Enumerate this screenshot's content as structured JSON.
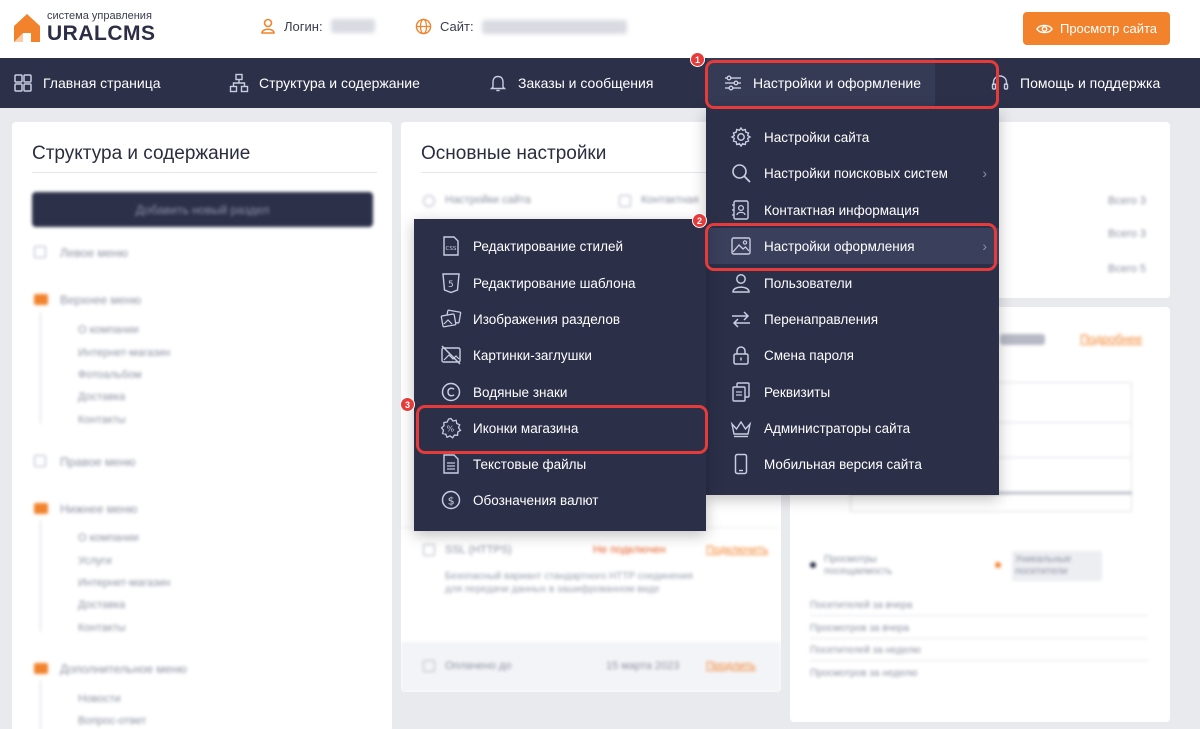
{
  "header": {
    "logo_sub": "система управления",
    "logo_main": "URALCMS",
    "login_label": "Логин:",
    "site_label": "Сайт:",
    "view_site_button": "Просмотр сайта"
  },
  "nav": {
    "items": [
      {
        "label": "Главная страница",
        "icon": "grid-icon"
      },
      {
        "label": "Структура и содержание",
        "icon": "sitemap-icon"
      },
      {
        "label": "Заказы и сообщения",
        "icon": "bell-icon"
      },
      {
        "label": "Настройки и оформление",
        "icon": "sliders-icon"
      },
      {
        "label": "Помощь и поддержка",
        "icon": "headset-icon"
      }
    ]
  },
  "left_panel": {
    "title": "Структура и содержание",
    "add_button": "Добавить новый раздел",
    "tree": [
      "Левое меню",
      "Верхнее меню",
      "О компании",
      "Интернет-магазин",
      "Фотоальбом",
      "Доставка",
      "Контакты",
      "Правое меню",
      "Нижнее меню",
      "О компании",
      "Услуги",
      "Интернет-магазин",
      "Доставка",
      "Контакты",
      "Дополнительное меню",
      "Новости",
      "Вопрос-ответ"
    ]
  },
  "middle_panel": {
    "title": "Основные настройки",
    "links": [
      "Настройки сайта",
      "Контактная"
    ],
    "ssl_label": "SSL (HTTPS)",
    "ssl_status": "Не подключен",
    "ssl_action": "Подключить",
    "ssl_desc": "Безопасный вариант стандартного HTTP соединения для передачи данных в зашифрованном виде",
    "paid_label": "Оплачено до",
    "paid_date": "15 марта 2023",
    "paid_action": "Продлить"
  },
  "right_panel": {
    "counts": [
      "Всего 3",
      "Всего 3",
      "Всего 5"
    ],
    "news_link": "Подробнее",
    "views": [
      "Просмотры посещаемость",
      "Уникальные посетители"
    ],
    "stats": [
      "Посетителей за вчера",
      "Просмотров за вчера",
      "Посетителей за неделю",
      "Просмотров за неделю"
    ]
  },
  "settings_menu": {
    "items": [
      {
        "label": "Настройки сайта",
        "icon": "gear-icon",
        "submenu": false
      },
      {
        "label": "Настройки поисковых систем",
        "icon": "search-icon",
        "submenu": true
      },
      {
        "label": "Контактная информация",
        "icon": "contact-card-icon",
        "submenu": false
      },
      {
        "label": "Настройки оформления",
        "icon": "image-icon",
        "submenu": true
      },
      {
        "label": "Пользователи",
        "icon": "user-icon",
        "submenu": false
      },
      {
        "label": "Перенаправления",
        "icon": "arrows-icon",
        "submenu": false
      },
      {
        "label": "Смена пароля",
        "icon": "lock-icon",
        "submenu": false
      },
      {
        "label": "Реквизиты",
        "icon": "documents-icon",
        "submenu": false
      },
      {
        "label": "Администраторы сайта",
        "icon": "crown-icon",
        "submenu": false
      },
      {
        "label": "Мобильная версия сайта",
        "icon": "mobile-icon",
        "submenu": false
      }
    ]
  },
  "design_menu": {
    "items": [
      {
        "label": "Редактирование стилей",
        "icon": "css-file-icon"
      },
      {
        "label": "Редактирование шаблона",
        "icon": "html5-icon"
      },
      {
        "label": "Изображения разделов",
        "icon": "pictures-icon"
      },
      {
        "label": "Картинки-заглушки",
        "icon": "no-image-icon"
      },
      {
        "label": "Водяные знаки",
        "icon": "copyright-icon"
      },
      {
        "label": "Иконки магазина",
        "icon": "percent-badge-icon"
      },
      {
        "label": "Текстовые файлы",
        "icon": "text-file-icon"
      },
      {
        "label": "Обозначения валют",
        "icon": "dollar-icon"
      }
    ]
  },
  "annotations": [
    "1",
    "2",
    "3"
  ],
  "colors": {
    "accent": "#f2832c",
    "nav_bg": "#2c3049",
    "menu_bg": "#2b2f48",
    "highlight": "#e53b3b"
  }
}
